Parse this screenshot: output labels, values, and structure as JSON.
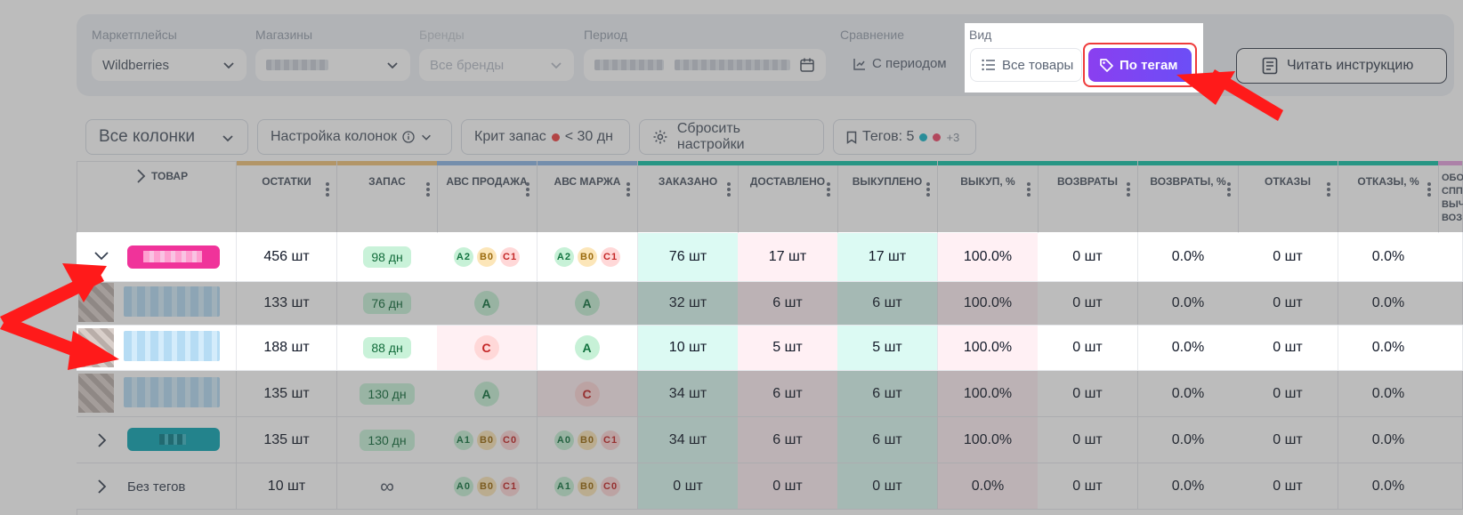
{
  "filters": {
    "marketplaces": {
      "label": "Маркетплейсы",
      "value": "Wildberries"
    },
    "stores": {
      "label": "Магазины"
    },
    "brands": {
      "label": "Бренды",
      "value": "Все бренды"
    },
    "period": {
      "label": "Период"
    },
    "comparison": {
      "label": "Сравнение",
      "value": "С периодом"
    },
    "view": {
      "label": "Вид",
      "all_products": "Все товары",
      "by_tags": "По тегам"
    },
    "read_instructions": "Читать инструкцию"
  },
  "toolbar": {
    "all_columns": "Все колонки",
    "column_settings": "Настройка колонок",
    "crit_stock_label": "Крит запас",
    "crit_stock_value": "< 30 дн",
    "reset_settings": "Сбросить настройки",
    "tags_label": "Тегов: 5",
    "tags_more": "+3"
  },
  "table": {
    "product_header": "ТОВАР",
    "columns": [
      "ОСТАТКИ",
      "ЗАПАС",
      "АВС ПРОДАЖА",
      "АВС МАРЖА",
      "ЗАКАЗАНО",
      "ДОСТАВЛЕНО",
      "ВЫКУПЛЕНО",
      "ВЫКУП, %",
      "ВОЗВРАТЫ",
      "ВОЗВРАТЫ, %",
      "ОТКАЗЫ",
      "ОТКАЗЫ, %"
    ],
    "last_col_lines": [
      "ОБО",
      "СПП",
      "ВЫЧ",
      "ВОЗ"
    ],
    "rows": [
      {
        "stock": "456 шт",
        "reserve": "98 дн",
        "abc_sale": [
          "A2",
          "B0",
          "C1"
        ],
        "abc_margin": [
          "A2",
          "B0",
          "C1"
        ],
        "cells": [
          "76 шт",
          "17 шт",
          "17 шт",
          "100.0%",
          "0 шт",
          "0.0%",
          "0 шт",
          "0.0%"
        ]
      },
      {
        "stock": "133 шт",
        "reserve": "76 дн",
        "abc_sale": [
          "A"
        ],
        "abc_margin": [
          "A"
        ],
        "cells": [
          "32 шт",
          "6 шт",
          "6 шт",
          "100.0%",
          "0 шт",
          "0.0%",
          "0 шт",
          "0.0%"
        ]
      },
      {
        "stock": "188 шт",
        "reserve": "88 дн",
        "abc_sale": [
          "C"
        ],
        "abc_margin": [
          "A"
        ],
        "cells": [
          "10 шт",
          "5 шт",
          "5 шт",
          "100.0%",
          "0 шт",
          "0.0%",
          "0 шт",
          "0.0%"
        ]
      },
      {
        "stock": "135 шт",
        "reserve": "130 дн",
        "abc_sale": [
          "A"
        ],
        "abc_margin": [
          "C"
        ],
        "cells": [
          "34 шт",
          "6 шт",
          "6 шт",
          "100.0%",
          "0 шт",
          "0.0%",
          "0 шт",
          "0.0%"
        ]
      },
      {
        "stock": "135 шт",
        "reserve": "130 дн",
        "abc_sale": [
          "A1",
          "B0",
          "C0"
        ],
        "abc_margin": [
          "A0",
          "B0",
          "C1"
        ],
        "cells": [
          "34 шт",
          "6 шт",
          "6 шт",
          "100.0%",
          "0 шт",
          "0.0%",
          "0 шт",
          "0.0%"
        ]
      },
      {
        "label": "Без тегов",
        "stock": "10 шт",
        "reserve": "∞",
        "abc_sale": [
          "A0",
          "B0",
          "C1"
        ],
        "abc_margin": [
          "A1",
          "B0",
          "C0"
        ],
        "cells": [
          "0 шт",
          "0 шт",
          "0 шт",
          "0.0%",
          "0 шт",
          "0.0%",
          "0 шт",
          "0.0%"
        ]
      }
    ]
  },
  "colors": {
    "accent_purple": "#7b46f3",
    "highlight_red": "#ef3b3b",
    "tag_pink": "#f0339a",
    "tag_teal": "#10a6b5"
  },
  "icons": [
    "chevron-down-icon",
    "calendar-icon",
    "list-icon",
    "tag-icon",
    "document-icon",
    "info-icon",
    "gear-icon",
    "bookmark-icon",
    "chevron-right-icon",
    "more-vertical-icon"
  ]
}
